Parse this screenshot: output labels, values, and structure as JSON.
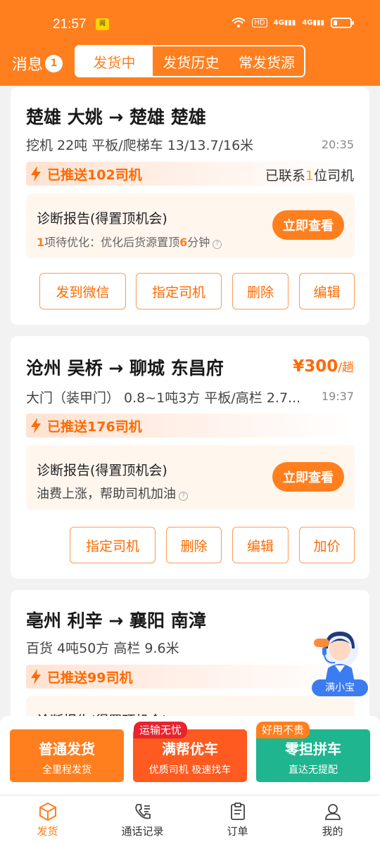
{
  "status": {
    "time": "21:57",
    "notif_badge": "阅",
    "hd": "HD",
    "signal1": "4G",
    "signal2": "4G"
  },
  "header": {
    "messages_label": "消息",
    "messages_count": "1",
    "tabs": [
      {
        "label": "发货中",
        "active": true
      },
      {
        "label": "发货历史"
      },
      {
        "label": "常发货源"
      }
    ]
  },
  "cards": [
    {
      "route": "楚雄 大姚 → 楚雄 楚雄",
      "desc": "挖机 22吨 平板/爬梯车 13/13.7/16米",
      "time": "20:35",
      "pushed": "已推送102司机",
      "contacted_prefix": "已联系",
      "contacted_num": "1",
      "contacted_suffix": "位司机",
      "diag_title": "诊断报告(得置顶机会)",
      "diag_num": "1",
      "diag_mid": "项待优化：优化后货源置顶",
      "diag_num2": "6",
      "diag_tail": "分钟",
      "view": "立即查看",
      "actions": [
        "发到微信",
        "指定司机",
        "删除",
        "编辑"
      ]
    },
    {
      "route": "沧州 吴桥 → 聊城 东昌府",
      "price": "¥300",
      "price_unit": "/趟",
      "desc": "大门（装甲门） 0.8~1吨3方 平板/高栏 2.7...",
      "time": "19:37",
      "pushed": "已推送176司机",
      "diag_title": "诊断报告(得置顶机会)",
      "diag_desc": "油费上涨，帮助司机加油",
      "view": "立即查看",
      "actions": [
        "指定司机",
        "删除",
        "编辑",
        "加价"
      ]
    },
    {
      "route": "亳州 利辛 → 襄阳 南漳",
      "desc": "百货 4吨50方 高栏 9.6米",
      "pushed": "已推送99司机",
      "diag_title": "诊断报告(得置顶机会)"
    }
  ],
  "assistant": {
    "label": "满小宝"
  },
  "publish": [
    {
      "title": "普通发货",
      "sub": "全里程发货",
      "color": "#ff7f1f"
    },
    {
      "title": "满帮优车",
      "sub": "优质司机  极速找车",
      "ribbon": "运输无忧",
      "color": "#ff5a1f"
    },
    {
      "title": "零担拼车",
      "sub": "直达无提配",
      "ribbon": "好用不贵",
      "color": "#1fb58f"
    }
  ],
  "nav": [
    {
      "label": "发货",
      "icon": "box-icon",
      "active": true
    },
    {
      "label": "通话记录",
      "icon": "phone-log-icon"
    },
    {
      "label": "订单",
      "icon": "order-icon"
    },
    {
      "label": "我的",
      "icon": "user-icon"
    }
  ]
}
